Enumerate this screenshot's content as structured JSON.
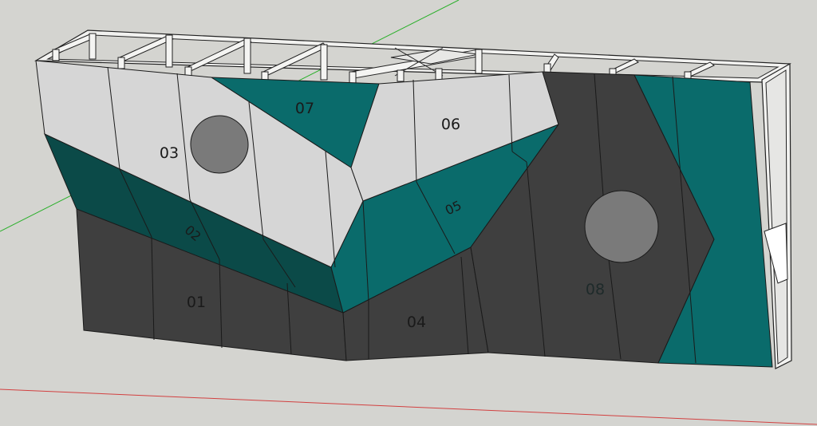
{
  "colors": {
    "background": "#d4d4d0",
    "light_panel": "#d6d6d6",
    "teal": "#0a6b6b",
    "dark_teal": "#0b4a48",
    "dark_panel": "#3f3f3f",
    "hold_circle": "#7a7a7a",
    "frame": "#f2f2f0",
    "axis_green": "#2bb02b",
    "axis_red": "#d24040"
  },
  "panels": [
    {
      "id": "01",
      "label": "01"
    },
    {
      "id": "02",
      "label": "02"
    },
    {
      "id": "03",
      "label": "03"
    },
    {
      "id": "04",
      "label": "04"
    },
    {
      "id": "05",
      "label": "05"
    },
    {
      "id": "06",
      "label": "06"
    },
    {
      "id": "07",
      "label": "07"
    },
    {
      "id": "08",
      "label": "08"
    }
  ]
}
